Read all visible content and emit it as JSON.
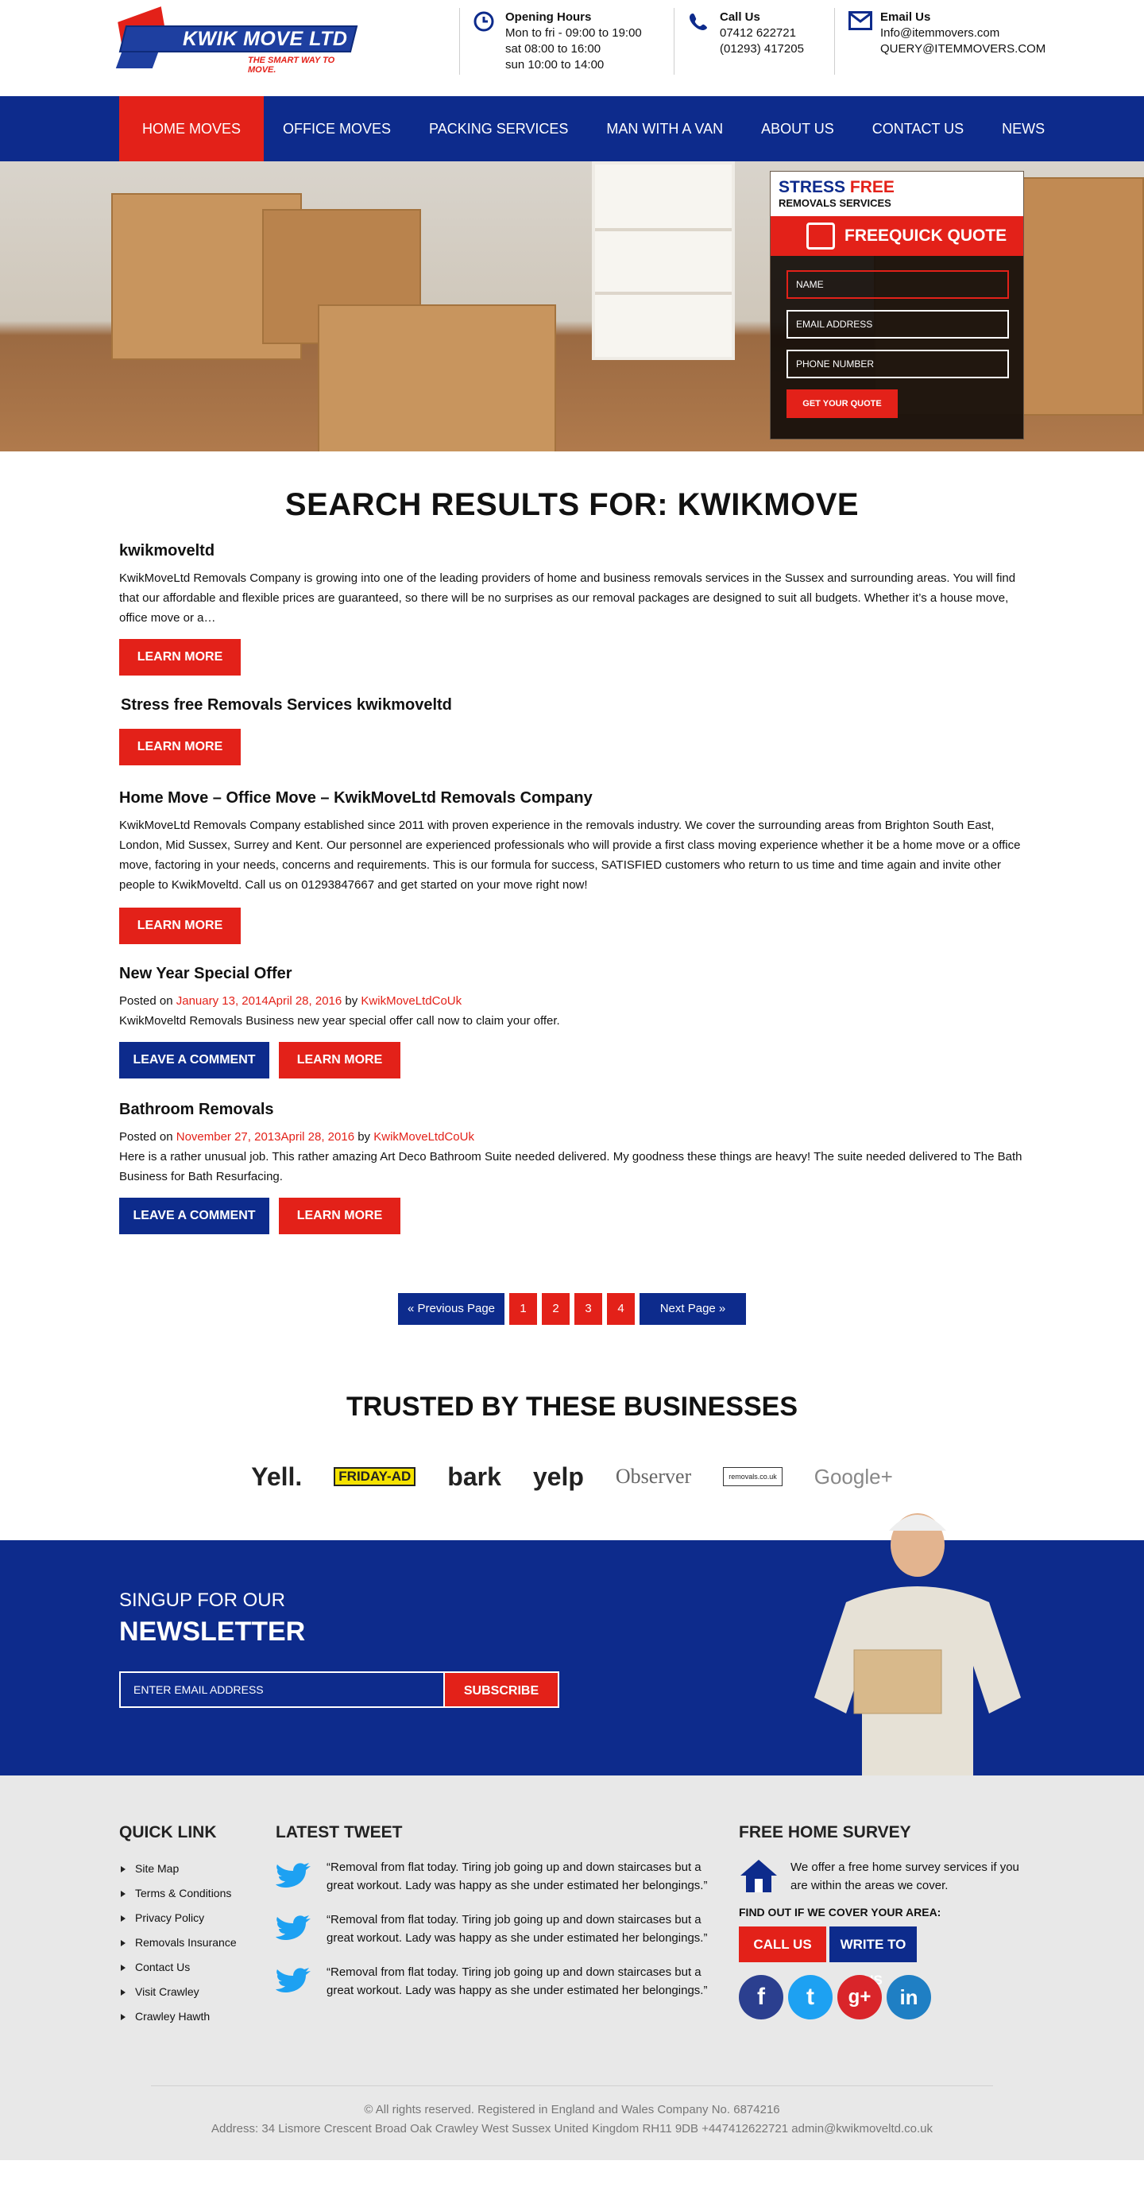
{
  "logo": {
    "name": "KWIK MOVE LTD",
    "tagline": "THE SMART WAY TO MOVE."
  },
  "header": {
    "hours": {
      "title": "Opening Hours",
      "lines": [
        "Mon to fri - 09:00  to 19:00",
        "sat 08:00  to 16:00",
        "sun 10:00 to 14:00"
      ]
    },
    "call": {
      "title": "Call Us",
      "lines": [
        "07412 622721",
        "(01293) 417205"
      ]
    },
    "email": {
      "title": "Email Us",
      "lines": [
        "Info@itemmovers.com",
        "QUERY@ITEMMOVERS.COM"
      ]
    }
  },
  "nav": [
    "HOME MOVES",
    "OFFICE MOVES",
    "PACKING SERVICES",
    "MAN WITH A VAN",
    "ABOUT US",
    "CONTACT US",
    "NEWS"
  ],
  "quote": {
    "stress": "STRESS",
    "free": "FREE",
    "sub": "REMOVALS SERVICES",
    "title": "FREEQUICK QUOTE",
    "name_placeholder": "NAME",
    "email_placeholder": "EMAIL ADDRESS",
    "phone_placeholder": "PHONE NUMBER",
    "button": "GET YOUR QUOTE"
  },
  "search_title": "SEARCH RESULTS FOR: KWIKMOVE",
  "results": [
    {
      "title": "kwikmoveltd",
      "text": "KwikMoveLtd Removals Company is growing into one of the leading providers of home and business removals services in the Sussex and surrounding areas. You will find that our affordable and flexible prices are guaranteed, so there will be no surprises as our removal packages are designed to suit all budgets. Whether it’s a house move, office move or a…",
      "learn": "LEARN MORE"
    },
    {
      "title": "Stress free Removals Services kwikmoveltd",
      "learn": "LEARN MORE"
    },
    {
      "title": "Home Move – Office Move – KwikMoveLtd Removals Company",
      "text": "KwikMoveLtd Removals Company established since 2011 with proven experience in the removals industry. We cover the surrounding areas from Brighton South East, London, Mid Sussex, Surrey and Kent. Our personnel are experienced professionals who will provide a first class moving experience whether it be a home move or a office move, factoring in your needs, concerns and requirements. This is our formula for success, SATISFIED customers who return to us time and time again and invite other people to KwikMoveltd. Call us on 01293847667 and get started on your move right now!",
      "learn": "LEARN MORE"
    },
    {
      "title": "New Year Special Offer",
      "posted": "Posted on",
      "date": "January 13, 2014April 28, 2016",
      "by": "by",
      "author": "KwikMoveLtdCoUk",
      "text": "KwikMoveltd Removals Business new year special offer call now to claim your offer.",
      "comment": "LEAVE A COMMENT",
      "learn": "LEARN MORE"
    },
    {
      "title": "Bathroom Removals",
      "posted": "Posted on",
      "date": "November 27, 2013April 28, 2016",
      "by": "by",
      "author": "KwikMoveLtdCoUk",
      "text": "Here is a rather unusual job. This rather amazing Art Deco Bathroom Suite needed delivered. My goodness these things are heavy! The suite needed delivered to The Bath Business for Bath Resurfacing.",
      "comment": "LEAVE A COMMENT",
      "learn": "LEARN MORE"
    }
  ],
  "pager": {
    "prev": "«  Previous Page",
    "pages": [
      "1",
      "2",
      "3",
      "4"
    ],
    "next": "Next Page  »"
  },
  "trusted": {
    "title": "TRUSTED BY THESE BUSINESSES",
    "logos": [
      "Yell.",
      "FRIDAY-AD",
      "bark",
      "yelp",
      "Observer",
      "removals.co.uk",
      "Google+"
    ]
  },
  "newsletter": {
    "line1": "SINGUP FOR OUR",
    "line2": "NEWSLETTER",
    "placeholder": "ENTER EMAIL ADDRESS",
    "button": "SUBSCRIBE"
  },
  "footer": {
    "quick_title": "QUICK LINK",
    "links": [
      "Site Map",
      "Terms & Conditions",
      "Privacy Policy",
      "Removals Insurance",
      "Contact Us",
      "Visit Crawley",
      "Crawley Hawth"
    ],
    "tweet_title": "LATEST TWEET",
    "tweets": [
      "“Removal from flat today. Tiring job going up and down staircases but a great workout. Lady was happy as she under estimated her belongings.”",
      "“Removal from flat today. Tiring job going up and down staircases but a great workout. Lady was happy as she under estimated her belongings.”",
      "“Removal from flat today. Tiring job going up and down staircases but a great workout. Lady was happy as she under estimated her belongings.”"
    ],
    "survey_title": "FREE HOME SURVEY",
    "survey_text": "We offer a free home survey services if you are within the areas we cover.",
    "find": "FIND OUT IF WE COVER YOUR AREA:",
    "call": "CALL US",
    "write": "WRITE TO US",
    "social": [
      "f",
      "t",
      "g+",
      "in"
    ],
    "copy1": "© All rights reserved. Registered in England and Wales Company No. 6874216",
    "copy2": "Address: 34 Lismore Crescent Broad Oak Crawley West Sussex United Kingdom RH11 9DB +447412622721 admin@kwikmoveltd.co.uk"
  }
}
